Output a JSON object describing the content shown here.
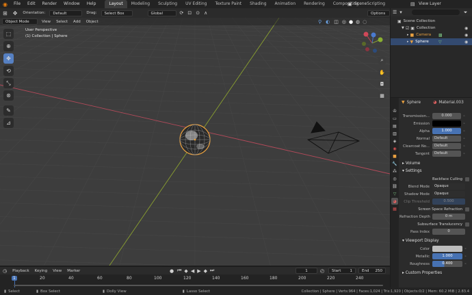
{
  "topbar": {
    "menus": [
      "File",
      "Edit",
      "Render",
      "Window",
      "Help"
    ],
    "workspaces": [
      "Layout",
      "Modeling",
      "Sculpting",
      "UV Editing",
      "Texture Paint",
      "Shading",
      "Animation",
      "Rendering",
      "Compositing",
      "Scripting"
    ],
    "scene_label": "Scene",
    "view_layer_label": "View Layer"
  },
  "vp_header": {
    "orientation_label": "Orientation:",
    "orientation_value": "Default",
    "drag_label": "Drag:",
    "drag_value": "Select Box",
    "transform_value": "Global",
    "options_label": "Options"
  },
  "vp_header2": {
    "mode": "Object Mode",
    "view": "View",
    "select": "Select",
    "add": "Add",
    "object": "Object"
  },
  "viewport": {
    "overlay_line1": "User Perspective",
    "overlay_line2": "(1) Collection | Sphere"
  },
  "outliner": {
    "title": "Scene Collection",
    "items": [
      {
        "name": "Collection"
      },
      {
        "name": "Camera"
      },
      {
        "name": "Sphere"
      }
    ]
  },
  "properties": {
    "object_name": "Sphere",
    "material_name": "Material.003",
    "rows_top": [
      {
        "label": "Transmission...",
        "value": "0.000",
        "style": "grey"
      },
      {
        "label": "Emission",
        "value": "",
        "style": "black"
      },
      {
        "label": "Alpha",
        "value": "1.000",
        "style": "blue"
      },
      {
        "label": "Normal",
        "value": "Default",
        "style": "grey"
      },
      {
        "label": "Clearcoat No...",
        "value": "Default",
        "style": "grey"
      },
      {
        "label": "Tangent",
        "value": "Default",
        "style": "grey"
      }
    ],
    "volume_section": "Volume",
    "settings_section": "Settings",
    "backface_culling": "Backface Culling",
    "blend_mode_label": "Blend Mode",
    "blend_mode_value": "Opaque",
    "shadow_mode_label": "Shadow Mode",
    "shadow_mode_value": "Opaque",
    "clip_threshold_label": "Clip Threshold",
    "clip_threshold_value": "0.500",
    "ssr_label": "Screen Space Refraction",
    "refraction_depth_label": "Refraction Depth",
    "refraction_depth_value": "0 m",
    "sss_label": "Subsurface Translucency",
    "pass_index_label": "Pass Index",
    "pass_index_value": "0",
    "viewport_display_section": "Viewport Display",
    "color_label": "Color",
    "metallic_label": "Metallic",
    "metallic_value": "1.000",
    "roughness_label": "Roughness",
    "roughness_value": "0.400",
    "custom_props_section": "Custom Properties"
  },
  "timeline": {
    "menus": [
      "Playback",
      "Keying",
      "View",
      "Marker"
    ],
    "current_frame": "1",
    "start_label": "Start",
    "start_value": "1",
    "end_label": "End",
    "end_value": "250",
    "ruler_frames": [
      "1",
      "20",
      "40",
      "60",
      "80",
      "100",
      "120",
      "140",
      "160",
      "180",
      "200",
      "220",
      "240"
    ]
  },
  "statusbar": {
    "select": "Select",
    "box_select": "Box Select",
    "dolly_view": "Dolly View",
    "lasso_select": "Lasso Select",
    "stats": "Collection | Sphere | Verts:964 | Faces:1,024 | Tris:1,920 | Objects:0/2 | Mem: 60.2 MiB | 2.83.4"
  },
  "colors": {
    "accent_blue": "#4772b3",
    "active_tool": "#5680c2",
    "x_axis": "#b54a5a",
    "y_axis": "#8aa030"
  }
}
